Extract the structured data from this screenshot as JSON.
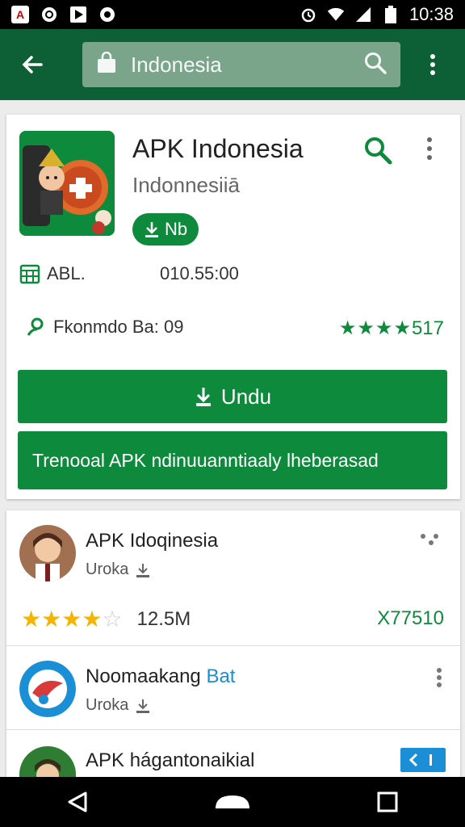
{
  "status_bar": {
    "time": "10:38",
    "icons": [
      "carrier-icon",
      "whatsapp-icon",
      "play-icon",
      "at-icon",
      "alarm-icon",
      "wifi-icon",
      "signal-icon",
      "battery-icon"
    ]
  },
  "toolbar": {
    "search_query": "Indonesia",
    "back_icon": "arrow-left-icon",
    "search_icon": "search-icon",
    "more_icon": "more-vert-icon"
  },
  "app": {
    "title": "APK Indonesia",
    "developer_line": "Indonnesiiā",
    "badge_label": "Nb",
    "info_label": "ABL.",
    "info_value": "010.55:00",
    "developer": "Fkonmdo Ba: 09",
    "rating_stars": "★★★★",
    "rating_count": "517",
    "install_label": "Undu",
    "promo_text": "Trenooal APK ndinuuanntiaaly lheberasad"
  },
  "list": [
    {
      "title": "APK Idoqinesia",
      "sub": "Uroka",
      "rating_count": "12.5M",
      "right_value": "X77510"
    },
    {
      "title": "Noomaakang",
      "title_accent": "Bat",
      "sub": "Uroka"
    },
    {
      "title": "APK hágantonaikial"
    }
  ],
  "colors": {
    "toolbar": "#0d5f35",
    "accent": "#0e8a3c",
    "search_bg": "#7ba58b",
    "star_yellow": "#f4b400",
    "blue_badge": "#1a8fd6"
  }
}
